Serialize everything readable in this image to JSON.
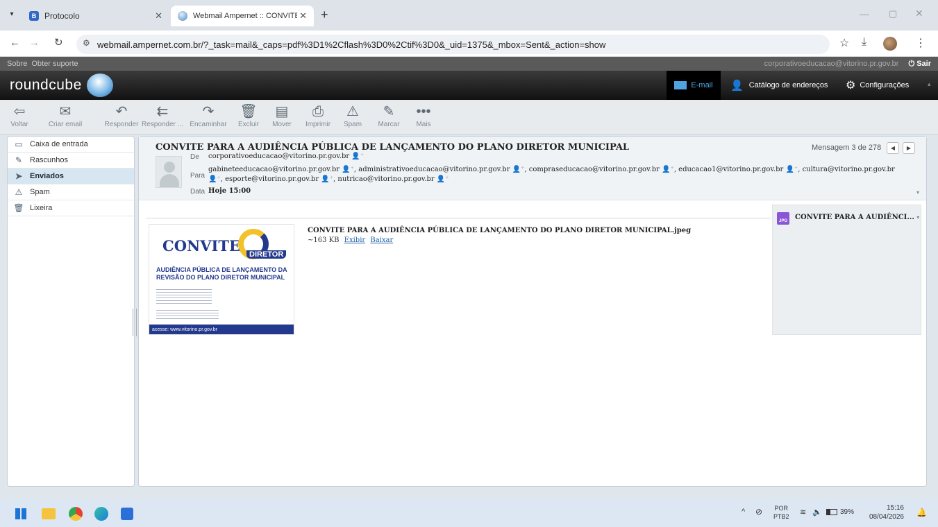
{
  "browser": {
    "tabs": [
      {
        "title": "Protocolo",
        "active": false
      },
      {
        "title": "Webmail Ampernet :: CONVITE",
        "active": true
      }
    ],
    "url": "webmail.ampernet.com.br/?_task=mail&_caps=pdf%3D1%2Cflash%3D0%2Ctif%3D0&_uid=1375&_mbox=Sent&_action=show"
  },
  "topline": {
    "about": "Sobre",
    "support": "Obter suporte",
    "user": "corporativoeducacao@vitorino.pr.gov.br",
    "logout": "Sair"
  },
  "header": {
    "logo": "roundcube",
    "nav": [
      {
        "label": "E-mail",
        "icon": "mail-icon"
      },
      {
        "label": "Catálogo de endereços",
        "icon": "person-icon"
      },
      {
        "label": "Configurações",
        "icon": "gear-icon"
      }
    ]
  },
  "toolbar": {
    "buttons": [
      {
        "label": "Voltar",
        "icon": "back-arrow-icon"
      },
      {
        "label": "Criar email",
        "icon": "compose-icon"
      },
      {
        "label": "Responder",
        "icon": "reply-icon"
      },
      {
        "label": "Responder ...",
        "icon": "reply-all-icon"
      },
      {
        "label": "Encaminhar",
        "icon": "forward-icon"
      },
      {
        "label": "Excluir",
        "icon": "trash-icon"
      },
      {
        "label": "Mover",
        "icon": "move-icon"
      },
      {
        "label": "Imprimir",
        "icon": "print-icon"
      },
      {
        "label": "Spam",
        "icon": "spam-icon"
      },
      {
        "label": "Marcar",
        "icon": "mark-icon"
      },
      {
        "label": "Mais",
        "icon": "more-icon"
      }
    ]
  },
  "folders": [
    {
      "label": "Caixa de entrada",
      "icon": "inbox-icon",
      "selected": false
    },
    {
      "label": "Rascunhos",
      "icon": "pencil-icon",
      "selected": false
    },
    {
      "label": "Enviados",
      "icon": "sent-icon",
      "selected": true
    },
    {
      "label": "Spam",
      "icon": "spam-icon",
      "selected": false
    },
    {
      "label": "Lixeira",
      "icon": "trash-icon",
      "selected": false
    }
  ],
  "message": {
    "subject": "CONVITE PARA A AUDIÊNCIA PÚBLICA DE LANÇAMENTO DO PLANO DIRETOR MUNICIPAL",
    "counter": "Mensagem 3 de 278",
    "from_label": "De",
    "from": "corporativoeducacao@vitorino.pr.gov.br",
    "to_label": "Para",
    "to": [
      "gabineteeducacao@vitorino.pr.gov.br",
      "administrativoeducacao@vitorino.pr.gov.br",
      "compraseducacao@vitorino.pr.gov.br",
      "educacao1@vitorino.pr.gov.br",
      "cultura@vitorino.pr.gov.br",
      "esporte@vitorino.pr.gov.br",
      "nutricao@vitorino.pr.gov.br"
    ],
    "date_label": "Data",
    "date": "Hoje 15:00"
  },
  "attachment": {
    "filename": "CONVITE PARA A AUDIÊNCIA PÚBLICA DE LANÇAMENTO DO PLANO DIRETOR MUNICIPAL.jpeg",
    "size": "~163 KB",
    "view": "Exibir",
    "download": "Baixar",
    "sidebar_name": "CONVITE PARA A AUDIÊNCI...",
    "sidebar_type": "JPG"
  },
  "thumbnail": {
    "convite": "CONVITE",
    "diretor": "DIRETOR",
    "line1": "AUDIÊNCIA PÚBLICA DE LANÇAMENTO DA",
    "line2": "REVISÃO DO PLANO DIRETOR MUNICIPAL",
    "footer": "acesse: www.vitorino.pr.gov.br"
  },
  "taskbar": {
    "lang_top": "POR",
    "lang_bottom": "PTB2",
    "battery": "39%",
    "time": "15:16",
    "date": "08/04/2026"
  },
  "colors": {
    "header_bg": "#1d1d1d",
    "selected_folder": "#d7e6f1",
    "link": "#1f61a6",
    "email_nav": "#4fa3e0"
  }
}
